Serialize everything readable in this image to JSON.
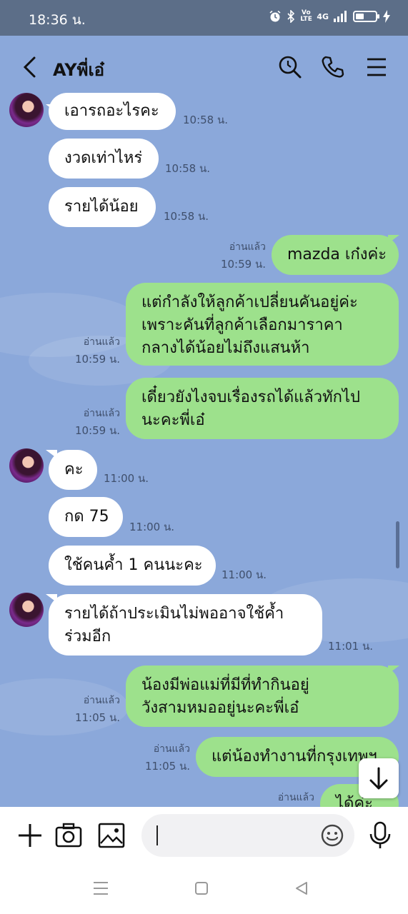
{
  "status_bar": {
    "time": "18:36 น.",
    "network": "4G",
    "volte": "Vo LTE"
  },
  "header": {
    "title": "AYพี่เอ๋"
  },
  "messages": [
    {
      "side": "in",
      "text": "เอารถอะไรคะ",
      "time": "10:58 น."
    },
    {
      "side": "in",
      "text": "งวดเท่าไหร่",
      "time": "10:58 น."
    },
    {
      "side": "in",
      "text": "รายได้น้อย",
      "time": "10:58 น."
    },
    {
      "side": "out",
      "text": "mazda เก๋งค่ะ",
      "read": "อ่านแล้ว",
      "time": "10:59 น."
    },
    {
      "side": "out",
      "lines": [
        "แต่กำลังให้ลูกค้าเปลี่ยนคันอยู่ค่ะ",
        "เพราะคันที่ลูกค้าเลือกมาราคา",
        "กลางได้น้อยไม่ถึงแสนห้า"
      ],
      "read": "อ่านแล้ว",
      "time": "10:59 น."
    },
    {
      "side": "out",
      "lines": [
        "เดี๋ยวยังไงจบเรื่องรถได้แล้วทักไป",
        "นะคะพี่เอ๋"
      ],
      "read": "อ่านแล้ว",
      "time": "10:59 น."
    },
    {
      "side": "in",
      "text": "คะ",
      "time": "11:00 น."
    },
    {
      "side": "in",
      "text": "กด 75",
      "time": "11:00 น."
    },
    {
      "side": "in",
      "text": "ใช้คนค้ำ 1 คนนะคะ",
      "time": "11:00 น."
    },
    {
      "side": "in",
      "lines": [
        "รายได้ถ้าประเมินไม่พออาจใช้ค้ำ",
        "ร่วมอีก"
      ],
      "time": "11:01 น."
    },
    {
      "side": "out",
      "lines": [
        "น้องมีพ่อแม่ที่มีที่ทำกินอยู่",
        "วังสามหมออยู่นะคะพี่เอ๋"
      ],
      "read": "อ่านแล้ว",
      "time": "11:05 น."
    },
    {
      "side": "out",
      "text": "แต่น้องทำงานที่กรุงเทพฯ",
      "read": "อ่านแล้ว",
      "time": "11:05 น."
    },
    {
      "side": "out",
      "text": "ได้ค่ะ",
      "read": "อ่านแล้ว",
      "time": ""
    }
  ],
  "input": {
    "placeholder": ""
  },
  "colors": {
    "chat_bg": "#8ba8da",
    "outgoing_bubble": "#9de18c",
    "incoming_bubble": "#ffffff",
    "status_bar": "#5c6e88"
  }
}
